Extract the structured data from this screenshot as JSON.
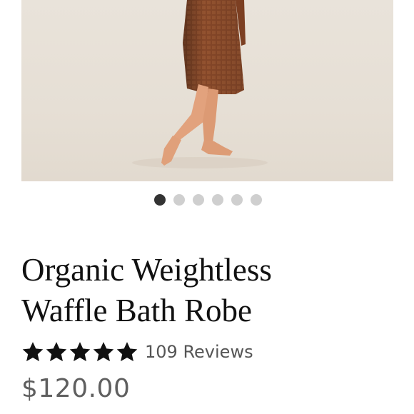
{
  "product": {
    "image_alt": "Organic Weightless Waffle Bath Robe photo",
    "carousel": {
      "count": 6,
      "active_index": 0
    },
    "title_lines": [
      "Organic Weightless",
      "Waffle Bath Robe"
    ],
    "rating": {
      "stars": 5,
      "max_stars": 5
    },
    "reviews_label": "109 Reviews",
    "price": "$120.00"
  },
  "colors": {
    "photo_background": "#e6dfd5",
    "robe_rust": "#8a4a2b",
    "active_dot": "#333333",
    "inactive_dot": "#cfcfcf",
    "star": "#111111"
  },
  "icons": {
    "star": "star-icon"
  }
}
